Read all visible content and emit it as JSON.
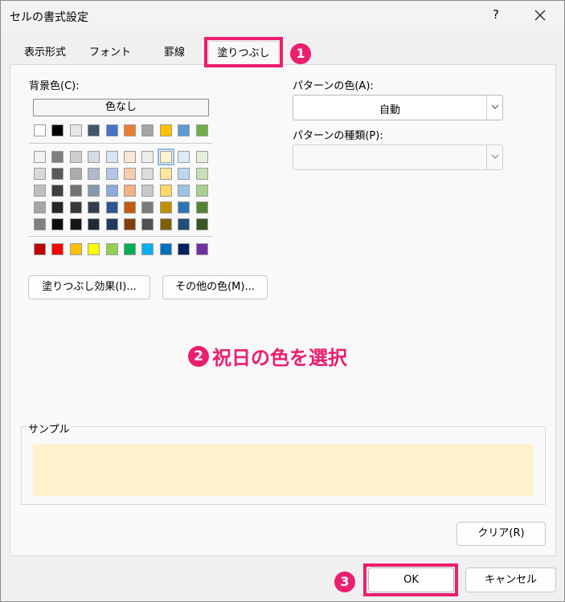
{
  "window": {
    "title": "セルの書式設定",
    "help_label": "?"
  },
  "tabs": [
    {
      "label": "表示形式"
    },
    {
      "label": "フォント"
    },
    {
      "label": "罫線"
    },
    {
      "label": "塗りつぶし"
    }
  ],
  "fill": {
    "bg_color_label": "背景色(C):",
    "no_color_label": "色なし",
    "theme_row": [
      "#ffffff",
      "#000000",
      "#e7e6e6",
      "#44546a",
      "#4472c4",
      "#ed7d31",
      "#a5a5a5",
      "#ffc000",
      "#5b9bd5",
      "#70ad47"
    ],
    "shade_rows": [
      [
        "#f2f2f2",
        "#7f7f7f",
        "#d0cece",
        "#d6dce4",
        "#d9e2f3",
        "#fbe5d5",
        "#ededed",
        "#fff2cc",
        "#ddebf7",
        "#e2efda"
      ],
      [
        "#d9d9d9",
        "#595959",
        "#aeaaaa",
        "#adb9ca",
        "#b4c6e7",
        "#f8cbad",
        "#dbdbdb",
        "#ffe699",
        "#bdd7ee",
        "#c6e0b4"
      ],
      [
        "#bfbfbf",
        "#3f3f3f",
        "#757171",
        "#8497b0",
        "#8ea9db",
        "#f4b084",
        "#c9c9c9",
        "#ffd966",
        "#9bc2e6",
        "#a9d08e"
      ],
      [
        "#a6a6a6",
        "#262626",
        "#3a3838",
        "#333f4f",
        "#2f5597",
        "#c55a11",
        "#7b7b7b",
        "#bf8f00",
        "#2e75b6",
        "#548235"
      ],
      [
        "#808080",
        "#0d0d0d",
        "#161616",
        "#222b35",
        "#1f3864",
        "#843c0b",
        "#525252",
        "#7f6000",
        "#1f4e78",
        "#375623"
      ]
    ],
    "standard_row": [
      "#c00000",
      "#ff0000",
      "#ffc000",
      "#ffff00",
      "#92d050",
      "#00b050",
      "#00b0f0",
      "#0070c0",
      "#002060",
      "#7030a0"
    ],
    "selected_color": "#fff2cc",
    "effects_button": "塗りつぶし効果(I)...",
    "more_colors_button": "その他の色(M)...",
    "pattern_color_label": "パターンの色(A):",
    "pattern_color_value": "自動",
    "pattern_style_label": "パターンの種類(P):",
    "pattern_style_value": "",
    "sample_label": "サンプル",
    "sample_color": "#fff2cc",
    "clear_button": "クリア(R)"
  },
  "footer": {
    "ok_label": "OK",
    "cancel_label": "キャンセル"
  },
  "annotations": {
    "step1": "1",
    "step2_num": "2",
    "step2_text": "祝日の色を選択",
    "step3": "3",
    "accent_color": "#ec1e6e"
  }
}
